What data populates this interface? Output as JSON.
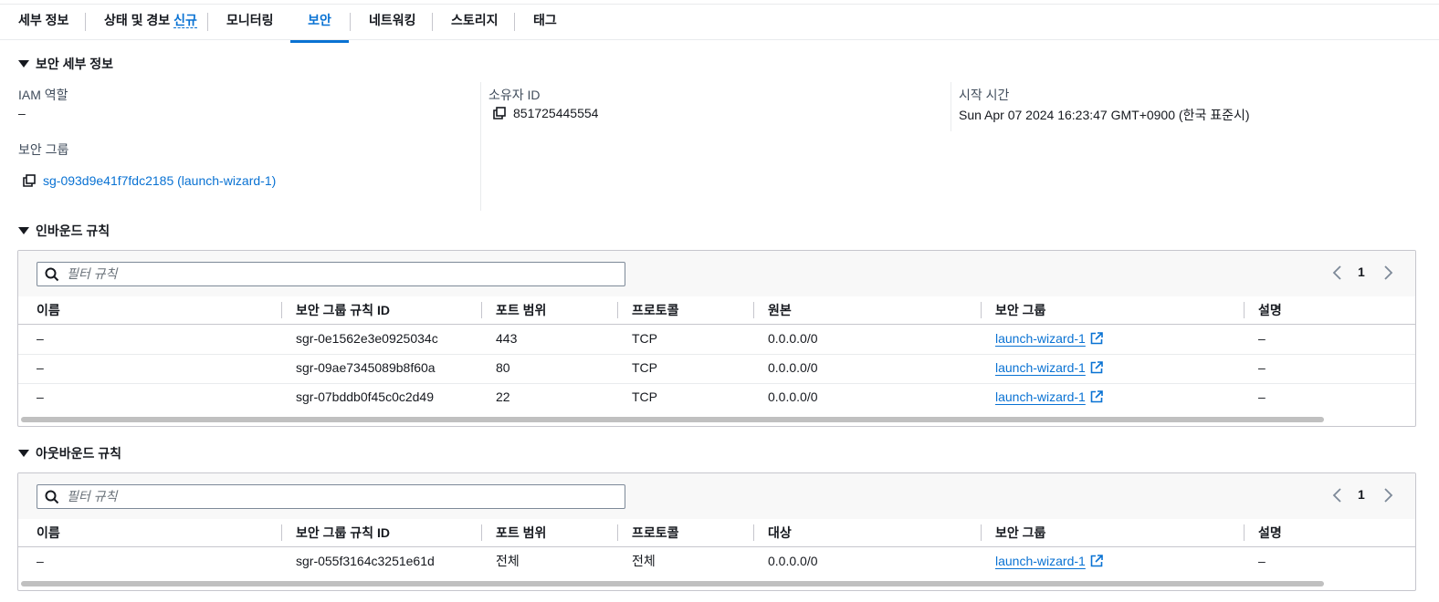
{
  "tabs": [
    {
      "label": "세부 정보"
    },
    {
      "label": "상태 및 경보",
      "badge": "신규"
    },
    {
      "label": "모니터링"
    },
    {
      "label": "보안",
      "active": true
    },
    {
      "label": "네트워킹"
    },
    {
      "label": "스토리지"
    },
    {
      "label": "태그"
    }
  ],
  "security_details": {
    "header": "보안 세부 정보",
    "iam_role_label": "IAM 역할",
    "iam_role_value": "–",
    "owner_id_label": "소유자 ID",
    "owner_id_value": "851725445554",
    "launch_time_label": "시작 시간",
    "launch_time_value": "Sun Apr 07 2024 16:23:47 GMT+0900 (한국 표준시)",
    "security_groups_label": "보안 그룹",
    "security_group_link": "sg-093d9e41f7fdc2185 (launch-wizard-1)"
  },
  "inbound": {
    "header": "인바운드 규칙",
    "filter_placeholder": "필터 규칙",
    "page": "1",
    "columns": [
      "이름",
      "보안 그룹 규칙 ID",
      "포트 범위",
      "프로토콜",
      "원본",
      "보안 그룹",
      "설명"
    ],
    "rows": [
      {
        "name": "–",
        "rule_id": "sgr-0e1562e3e0925034c",
        "port": "443",
        "protocol": "TCP",
        "source": "0.0.0.0/0",
        "group": "launch-wizard-1",
        "desc": "–"
      },
      {
        "name": "–",
        "rule_id": "sgr-09ae7345089b8f60a",
        "port": "80",
        "protocol": "TCP",
        "source": "0.0.0.0/0",
        "group": "launch-wizard-1",
        "desc": "–"
      },
      {
        "name": "–",
        "rule_id": "sgr-07bddb0f45c0c2d49",
        "port": "22",
        "protocol": "TCP",
        "source": "0.0.0.0/0",
        "group": "launch-wizard-1",
        "desc": "–"
      }
    ]
  },
  "outbound": {
    "header": "아웃바운드 규칙",
    "filter_placeholder": "필터 규칙",
    "page": "1",
    "columns": [
      "이름",
      "보안 그룹 규칙 ID",
      "포트 범위",
      "프로토콜",
      "대상",
      "보안 그룹",
      "설명"
    ],
    "rows": [
      {
        "name": "–",
        "rule_id": "sgr-055f3164c3251e61d",
        "port": "전체",
        "protocol": "전체",
        "source": "0.0.0.0/0",
        "group": "launch-wizard-1",
        "desc": "–"
      }
    ]
  },
  "colors": {
    "accent": "#0972d3",
    "text": "#16191f",
    "border": "#c6c6cd"
  },
  "icons": {
    "copy": "copy-icon",
    "external": "external-link-icon",
    "search": "search-icon",
    "caret": "caret-down-icon"
  }
}
